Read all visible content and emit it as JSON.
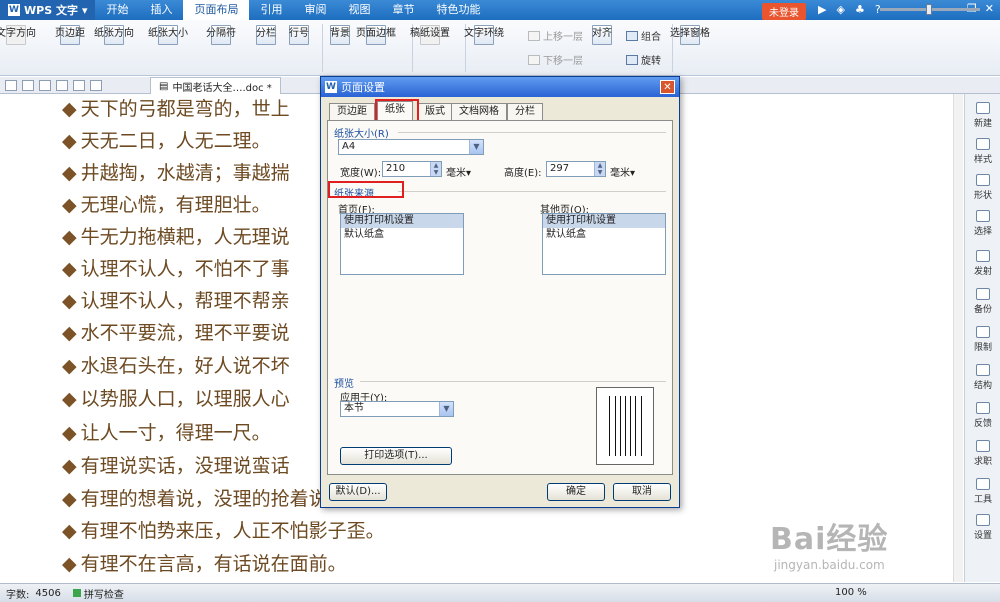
{
  "menubar": {
    "app_name": "WPS 文字",
    "items": [
      "开始",
      "插入",
      "页面布局",
      "引用",
      "审阅",
      "视图",
      "章节",
      "特色功能"
    ],
    "active": "页面布局",
    "login": "未登录",
    "help": "?"
  },
  "ribbon": {
    "text_direction": "文字方向",
    "margins": "页边距",
    "orientation": "纸张方向",
    "size": "纸张大小",
    "breaks": "分隔符",
    "columns": "分栏",
    "line_numbers": "行号",
    "background": "背景",
    "page_border": "页面边框",
    "manuscript": "稿纸设置",
    "text_wrap": "文字环绕",
    "bring_forward": "上移一层",
    "send_backward": "下移一层",
    "align": "对齐",
    "group": "组合",
    "rotate": "旋转",
    "selection_pane": "选择窗格"
  },
  "tabstrip": {
    "document_name": "中国老话大全….doc *",
    "new_tab": "+"
  },
  "document": {
    "lines": [
      "天下的弓都是弯的，世上",
      "天无二日，人无二理。",
      "井越掏，水越清；事越揣",
      "无理心慌，有理胆壮。",
      "牛无力拖横耙，人无理说",
      "认理不认人，不怕不了事",
      "认理不认人，帮理不帮亲",
      "水不平要流，理不平要说",
      "水退石头在，好人说不坏",
      "以势服人口，以理服人心",
      "让人一寸，得理一尺。",
      "有理说实话，没理说蛮话",
      "有理的想着说，没理的抢着说",
      "有理不怕势来压，人正不怕影子歪。",
      "有理不在言高，有话说在面前。"
    ]
  },
  "right_panel": [
    "新建",
    "样式",
    "形状",
    "选择",
    "发射",
    "备份",
    "限制",
    "结构",
    "反馈",
    "求职",
    "工具",
    "设置"
  ],
  "dialog": {
    "title": "页面设置",
    "tabs": [
      "页边距",
      "纸张",
      "版式",
      "文档网格",
      "分栏"
    ],
    "active_tab": "纸张",
    "paper_size": {
      "group": "纸张大小(R)",
      "value": "A4",
      "width_label": "宽度(W):",
      "width_value": "210",
      "height_label": "高度(E):",
      "height_value": "297",
      "unit": "毫米▾"
    },
    "paper_source": {
      "group": "纸张来源",
      "first_page_label": "首页(F):",
      "other_pages_label": "其他页(O):",
      "first_page_options": [
        "使用打印机设置",
        "默认纸盒"
      ],
      "other_pages_options": [
        "使用打印机设置",
        "默认纸盒"
      ]
    },
    "preview": {
      "group": "预览",
      "apply_to_label": "应用于(Y):",
      "apply_to_value": "本节"
    },
    "print_options": "打印选项(T)...",
    "default": "默认(D)...",
    "ok": "确定",
    "cancel": "取消"
  },
  "status": {
    "word_count_label": "字数:",
    "word_count": "4506",
    "spell_check": "拼写检查",
    "zoom": "100 %"
  },
  "watermark": {
    "brand": "Bai经验",
    "url": "jingyan.baidu.com"
  }
}
